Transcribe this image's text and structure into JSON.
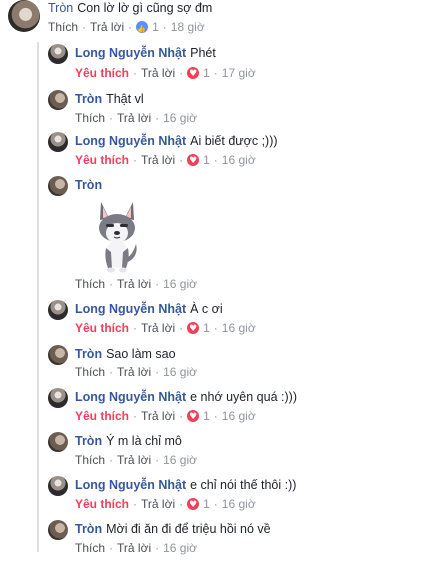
{
  "comments": [
    {
      "author": "Tròn",
      "text": "Con lờ lờ gì cũng sợ đm",
      "like": "Thích",
      "reply": "Trả lời",
      "count": "1",
      "time": "18 giờ",
      "reaction": "like-icon"
    },
    {
      "author": "Long Nguyễn Nhật",
      "text": "Phét",
      "like": "Yêu thích",
      "reply": "Trả lời",
      "count": "1",
      "time": "17 giờ",
      "reaction": "love-icon"
    },
    {
      "author": "Tròn",
      "text": "Thật vl",
      "like": "Thích",
      "reply": "Trả lời",
      "time": "16 giờ"
    },
    {
      "author": "Long Nguyễn Nhật",
      "text": "Ai biết được ;)))",
      "like": "Yêu thích",
      "reply": "Trả lời",
      "count": "1",
      "time": "16 giờ",
      "reaction": "love-icon"
    },
    {
      "author": "Tròn",
      "text": "",
      "like": "Thích",
      "reply": "Trả lời",
      "time": "16 giờ",
      "sticker": "husky-dog-sticker"
    },
    {
      "author": "Long Nguyễn Nhật",
      "text": "À c ơi",
      "like": "Yêu thích",
      "reply": "Trả lời",
      "count": "1",
      "time": "16 giờ",
      "reaction": "love-icon"
    },
    {
      "author": "Tròn",
      "text": "Sao làm sao",
      "like": "Thích",
      "reply": "Trả lời",
      "time": "16 giờ"
    },
    {
      "author": "Long Nguyễn Nhật",
      "text": "e nhớ uyên quá :)))",
      "like": "Yêu thích",
      "reply": "Trả lời",
      "count": "1",
      "time": "16 giờ",
      "reaction": "love-icon"
    },
    {
      "author": "Tròn",
      "text": "Ý m là chỉ mô",
      "like": "Thích",
      "reply": "Trả lời",
      "time": "16 giờ"
    },
    {
      "author": "Long Nguyễn Nhật",
      "text": "e chỉ nói thế thôi :))",
      "like": "Yêu thích",
      "reply": "Trả lời",
      "count": "1",
      "time": "16 giờ",
      "reaction": "love-icon"
    },
    {
      "author": "Tròn",
      "text": "Mời đi ăn đi để triệu hồi nó về",
      "like": "Thích",
      "reply": "Trả lời",
      "time": "16 giờ"
    }
  ],
  "colors": {
    "author": "#365899",
    "love": "#f33e58",
    "like": "#5890ff",
    "meta": "#90949c"
  }
}
